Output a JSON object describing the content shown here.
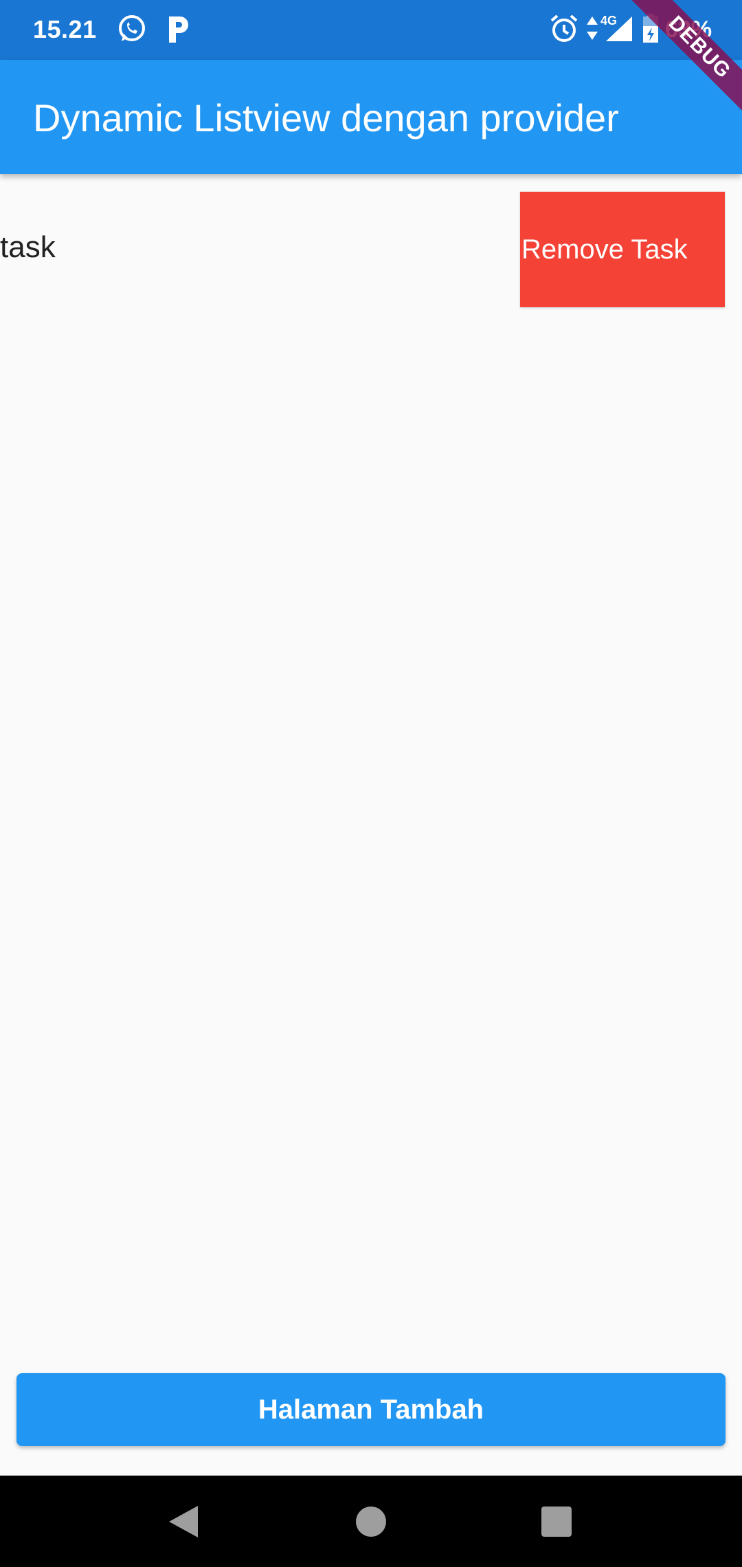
{
  "status_bar": {
    "time": "15.21",
    "battery": "63%",
    "network": "4G",
    "icons": [
      "whatsapp-icon",
      "p-app-icon",
      "alarm-icon",
      "data-arrows-icon",
      "signal-icon",
      "battery-icon"
    ]
  },
  "app_bar": {
    "title": "Dynamic Listview dengan provider"
  },
  "debug_banner": {
    "label": "DEBUG"
  },
  "task_list": {
    "items": [
      {
        "label": "task",
        "remove_label": "Remove Task"
      }
    ]
  },
  "bottom_button": {
    "label": "Halaman Tambah"
  },
  "nav_bar": {
    "buttons": [
      "back-icon",
      "home-icon",
      "recents-icon"
    ]
  },
  "colors": {
    "status_bar": "#1976d2",
    "app_bar": "#2196f3",
    "remove_button": "#f44336",
    "background": "#fafafa",
    "debug_banner": "#880e4f"
  }
}
